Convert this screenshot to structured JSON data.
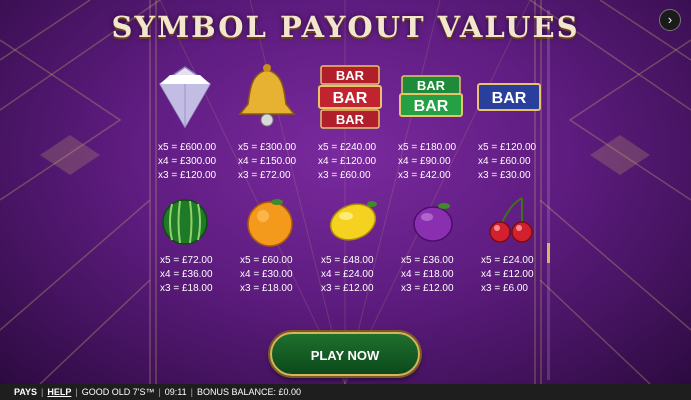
{
  "title": "SYMBOL PAYOUT VALUES",
  "next_icon": "chevron-right-icon",
  "symbols_row1": [
    {
      "name": "diamond",
      "icon": "diamond-icon",
      "payouts": [
        "x5 = £600.00",
        "x4 = £300.00",
        "x3 = £120.00"
      ]
    },
    {
      "name": "bell",
      "icon": "bell-icon",
      "payouts": [
        "x5 = £300.00",
        "x4 = £150.00",
        "x3 = £72.00"
      ]
    },
    {
      "name": "triple-bar",
      "icon": "triple-bar-icon",
      "payouts": [
        "x5 = £240.00",
        "x4 = £120.00",
        "x3 = £60.00"
      ]
    },
    {
      "name": "double-bar",
      "icon": "double-bar-icon",
      "payouts": [
        "x5 = £180.00",
        "x4 = £90.00",
        "x3 = £42.00"
      ]
    },
    {
      "name": "single-bar",
      "icon": "single-bar-icon",
      "payouts": [
        "x5 = £120.00",
        "x4 = £60.00",
        "x3 = £30.00"
      ]
    }
  ],
  "symbols_row2": [
    {
      "name": "watermelon",
      "icon": "watermelon-icon",
      "payouts": [
        "x5 = £72.00",
        "x4 = £36.00",
        "x3 = £18.00"
      ]
    },
    {
      "name": "orange",
      "icon": "orange-icon",
      "payouts": [
        "x5 = £60.00",
        "x4 = £30.00",
        "x3 = £18.00"
      ]
    },
    {
      "name": "lemon",
      "icon": "lemon-icon",
      "payouts": [
        "x5 = £48.00",
        "x4 = £24.00",
        "x3 = £12.00"
      ]
    },
    {
      "name": "plum",
      "icon": "plum-icon",
      "payouts": [
        "x5 = £36.00",
        "x4 = £18.00",
        "x3 = £12.00"
      ]
    },
    {
      "name": "cherries",
      "icon": "cherries-icon",
      "payouts": [
        "x5 = £24.00",
        "x4 = £12.00",
        "x3 = £6.00"
      ]
    }
  ],
  "bar_label": "BAR",
  "play_button": "PLAY NOW",
  "statusbar": {
    "pays": "PAYS",
    "help": "HELP",
    "game_name": "GOOD OLD 7'S™",
    "time": "09:11",
    "bonus_balance": "BONUS BALANCE: £0.00"
  },
  "colors": {
    "background": "#5e1c80",
    "title": "#f3e6cf",
    "play_button": "#1f6f2e",
    "gold": "#d9b35c"
  }
}
